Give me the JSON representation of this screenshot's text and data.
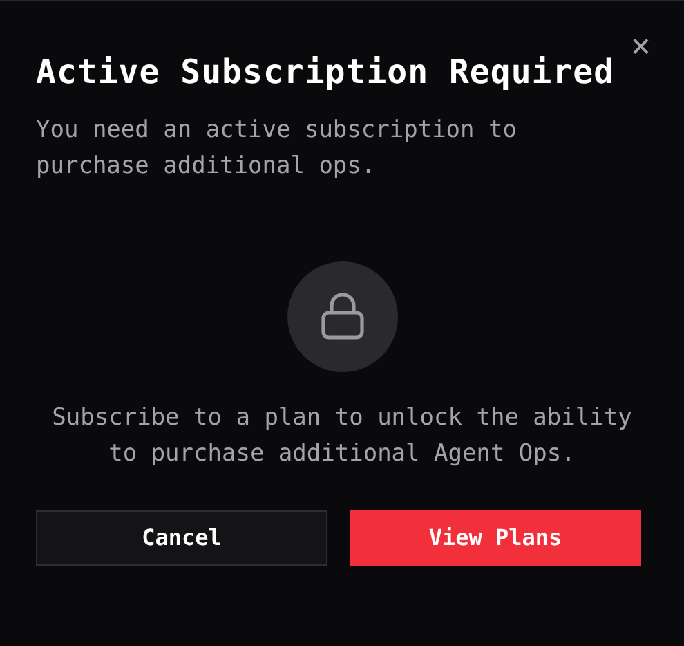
{
  "dialog": {
    "title": "Active Subscription Required",
    "close": "×",
    "description": "You need an active subscription to purchase additional ops.",
    "message": "Subscribe to a plan to unlock the ability to purchase additional Agent Ops.",
    "buttons": [
      {
        "label": "Cancel",
        "kind": "secondary"
      },
      {
        "label": "View Plans",
        "kind": "primary"
      }
    ]
  }
}
